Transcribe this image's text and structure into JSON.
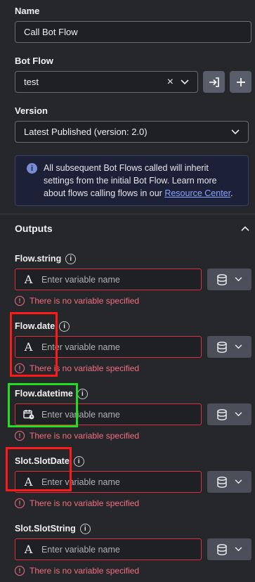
{
  "name": {
    "label": "Name",
    "value": "Call Bot Flow"
  },
  "bot_flow": {
    "label": "Bot Flow",
    "value": "test",
    "clear_glyph": "×"
  },
  "version": {
    "label": "Version",
    "value": "Latest Published (version: 2.0)"
  },
  "info": {
    "text": "All subsequent Bot Flows called will inherit settings from the initial Bot Flow. Learn more about flows calling flows in our ",
    "link": "Resource Center",
    "tail": "."
  },
  "outputs": {
    "title": "Outputs",
    "items": [
      {
        "label": "Flow.string",
        "placeholder": "Enter variable name",
        "type_icon": "text-type-icon",
        "error": "There is no variable specified"
      },
      {
        "label": "Flow.date",
        "placeholder": "Enter variable name",
        "type_icon": "text-type-icon",
        "error": "There is no variable specified"
      },
      {
        "label": "Flow.datetime",
        "placeholder": "Enter variable name",
        "type_icon": "calendar-clock-icon",
        "error": "There is no variable specified"
      },
      {
        "label": "Slot.SlotDate",
        "placeholder": "Enter variable name",
        "type_icon": "text-type-icon",
        "error": "There is no variable specified"
      },
      {
        "label": "Slot.SlotString",
        "placeholder": "Enter variable name",
        "type_icon": "text-type-icon",
        "error": "There is no variable specified"
      }
    ]
  },
  "help_glyph": "i",
  "error_glyph": "!",
  "type_glyph": "A",
  "colors": {
    "error": "#d8313d",
    "highlight_red": "#ff1a1a",
    "highlight_green": "#22dd22",
    "link": "#8aa4ff"
  }
}
